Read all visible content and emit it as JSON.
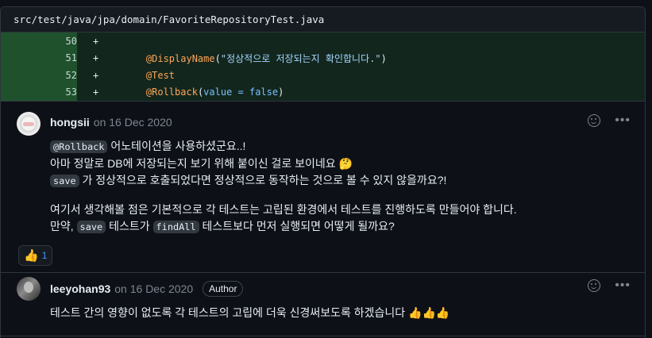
{
  "file": {
    "path": "src/test/java/jpa/domain/FavoriteRepositoryTest.java"
  },
  "diff": {
    "lines": [
      {
        "num": "50",
        "marker": "+",
        "tokens": []
      },
      {
        "num": "51",
        "marker": "+",
        "tokens": [
          {
            "t": "    ",
            "c": "punc"
          },
          {
            "t": "@DisplayName",
            "c": "ann"
          },
          {
            "t": "(",
            "c": "punc"
          },
          {
            "t": "\"정상적으로 저장되는지 확인합니다.\"",
            "c": "str"
          },
          {
            "t": ")",
            "c": "punc"
          }
        ]
      },
      {
        "num": "52",
        "marker": "+",
        "tokens": [
          {
            "t": "    ",
            "c": "punc"
          },
          {
            "t": "@Test",
            "c": "ann"
          }
        ]
      },
      {
        "num": "53",
        "marker": "+",
        "tokens": [
          {
            "t": "    ",
            "c": "punc"
          },
          {
            "t": "@Rollback",
            "c": "ann"
          },
          {
            "t": "(",
            "c": "punc"
          },
          {
            "t": "value",
            "c": "kw"
          },
          {
            "t": " = ",
            "c": "kw"
          },
          {
            "t": "false",
            "c": "kw"
          },
          {
            "t": ")",
            "c": "punc"
          }
        ]
      }
    ]
  },
  "comments": [
    {
      "author": "hongsii",
      "date": "on 16 Dec 2020",
      "badge": "",
      "p1_line1_code": "@Rollback",
      "p1_line1_text": " 어노테이션을 사용하셨군요..!",
      "p1_line2_text": "아마 정말로 DB에 저장되는지 보기 위해 붙이신 걸로 보이네요 ",
      "p1_line2_emoji": "🤔",
      "p1_line3_code": "save",
      "p1_line3_text": " 가 정상적으로 호출되었다면 정상적으로 동작하는 것으로 볼 수 있지 않을까요?!",
      "p2_line1_text": "여기서 생각해볼 점은 기본적으로 각 테스트는 고립된 환경에서 테스트를 진행하도록 만들어야 합니다.",
      "p2_line2_a": "만약, ",
      "p2_line2_code1": "save",
      "p2_line2_b": " 테스트가 ",
      "p2_line2_code2": "findAll",
      "p2_line2_c": " 테스트보다 먼저 실행되면 어떻게 될까요?",
      "reaction_emoji": "👍",
      "reaction_count": "1"
    },
    {
      "author": "leeyohan93",
      "date": "on 16 Dec 2020",
      "badge": "Author",
      "text": "테스트 간의 영향이 없도록 각 테스트의 고립에 더욱 신경써보도록 하겠습니다 ",
      "emoji": "👍👍👍"
    }
  ],
  "icons": {
    "reaction": "smiley-icon",
    "menu": "kebab-horizontal-icon"
  },
  "colors": {
    "added_bg": "#1b3a27",
    "annotation": "#ffa657",
    "string": "#a5d6ff",
    "keyword": "#79c0ff",
    "link": "#4493f8"
  }
}
